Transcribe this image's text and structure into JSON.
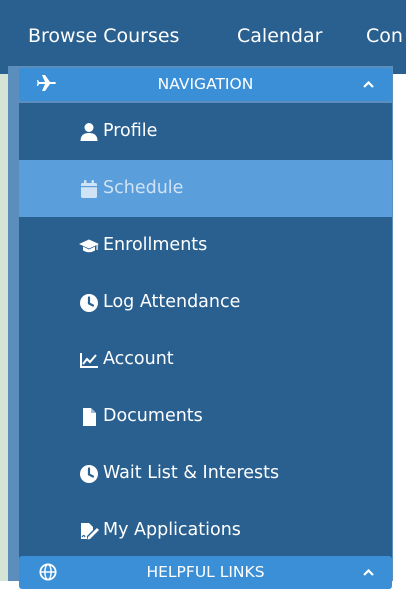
{
  "top_nav": {
    "items": [
      {
        "label": "Browse Courses"
      },
      {
        "label": "Calendar"
      },
      {
        "label": "Con"
      }
    ]
  },
  "navigation_panel": {
    "title": "NAVIGATION",
    "lead_icon": "plane-icon",
    "state_icon": "chevron-up-icon",
    "items": [
      {
        "label": "Profile",
        "icon": "user-icon",
        "active": false
      },
      {
        "label": "Schedule",
        "icon": "calendar-icon",
        "active": true
      },
      {
        "label": "Enrollments",
        "icon": "graduation-cap-icon",
        "active": false
      },
      {
        "label": "Log Attendance",
        "icon": "clock-icon",
        "active": false
      },
      {
        "label": "Account",
        "icon": "line-chart-icon",
        "active": false
      },
      {
        "label": "Documents",
        "icon": "file-icon",
        "active": false
      },
      {
        "label": "Wait List & Interests",
        "icon": "clock-icon",
        "active": false
      },
      {
        "label": "My Applications",
        "icon": "file-signature-icon",
        "active": false
      }
    ]
  },
  "helpful_links_panel": {
    "title": "HELPFUL LINKS",
    "lead_icon": "globe-icon",
    "state_icon": "chevron-up-icon"
  },
  "colors": {
    "topbar": "#2a6090",
    "menu_bg": "#2a6090",
    "panel_header": "#3a8fd7",
    "active_item": "#5a9edb",
    "sidebar_frame": "#5b8ebd",
    "page_background": "#d6e4d6"
  }
}
